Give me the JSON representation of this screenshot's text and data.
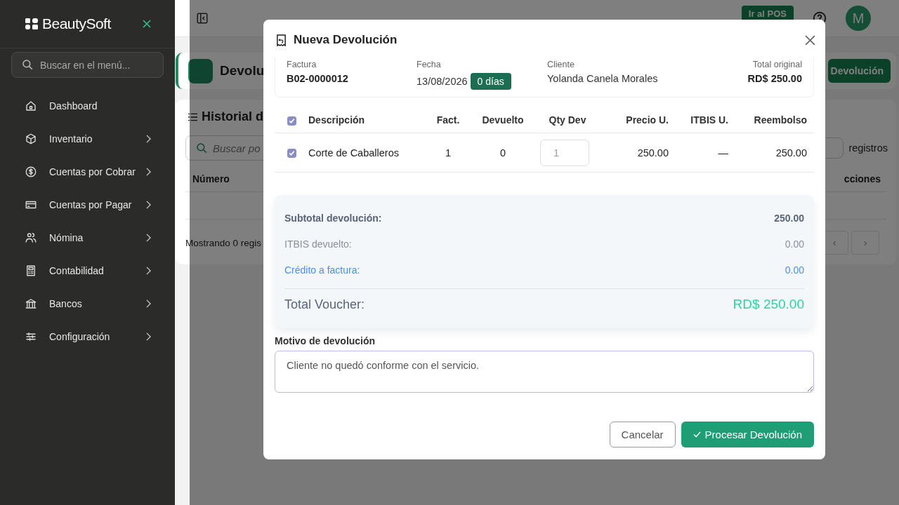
{
  "sidebar": {
    "brand": "BeautySoft",
    "search": {
      "placeholder": "Buscar en el menú..."
    },
    "items": [
      {
        "label": "Dashboard",
        "expandable": false
      },
      {
        "label": "Inventario",
        "expandable": true
      },
      {
        "label": "Cuentas por Cobrar",
        "expandable": true
      },
      {
        "label": "Cuentas por Pagar",
        "expandable": true
      },
      {
        "label": "Nómina",
        "expandable": true
      },
      {
        "label": "Contabilidad",
        "expandable": true
      },
      {
        "label": "Bancos",
        "expandable": true
      },
      {
        "label": "Configuración",
        "expandable": true
      }
    ]
  },
  "topbar": {
    "pos_button": "Ir al POS",
    "avatar": "M"
  },
  "page": {
    "title": "Devolu",
    "new_button": "Devolución",
    "history_title": "Historial d",
    "search": {
      "placeholder": "Buscar po"
    },
    "page_size_label": "registros",
    "columns": [
      "Número",
      "cciones"
    ],
    "footer": "Mostrando 0 regis",
    "pager": [
      "‹",
      "›"
    ]
  },
  "modal": {
    "title": "Nueva Devolución",
    "invoice": [
      {
        "label": "Factura",
        "value": "B02-0000012",
        "kind": "bold"
      },
      {
        "label": "Fecha",
        "value": "13/08/2026",
        "badge": "0 días",
        "kind": "date"
      },
      {
        "label": "Cliente",
        "value": "Yolanda Canela Morales",
        "kind": "plain"
      },
      {
        "label": "Total original",
        "value": "RD$ 250.00",
        "kind": "total"
      }
    ],
    "all_checked": true,
    "columns": [
      "Descripción",
      "Fact.",
      "Devuelto",
      "Qty Dev",
      "Precio U.",
      "ITBIS U.",
      "Reembolso"
    ],
    "rows": [
      {
        "checked": true,
        "description": "Corte de Caballeros",
        "fact": "1",
        "returned": "0",
        "qty_placeholder": "1",
        "price": "250.00",
        "itbis": "—",
        "refund": "250.00"
      }
    ],
    "summary": [
      {
        "kind": "subtotal",
        "label": "Subtotal devolución:",
        "value": "250.00"
      },
      {
        "kind": "muted",
        "label": "ITBIS devuelto:",
        "value": "0.00"
      },
      {
        "kind": "credit",
        "label": "Crédito a factura:",
        "value": "0.00"
      },
      {
        "kind": "total",
        "label": "Total Voucher:",
        "value": "RD$ 250.00"
      }
    ],
    "reason": {
      "label": "Motivo de devolución",
      "value": "Cliente no quedó conforme con el servicio."
    },
    "cancel": "Cancelar",
    "submit": "Procesar Devolución"
  }
}
